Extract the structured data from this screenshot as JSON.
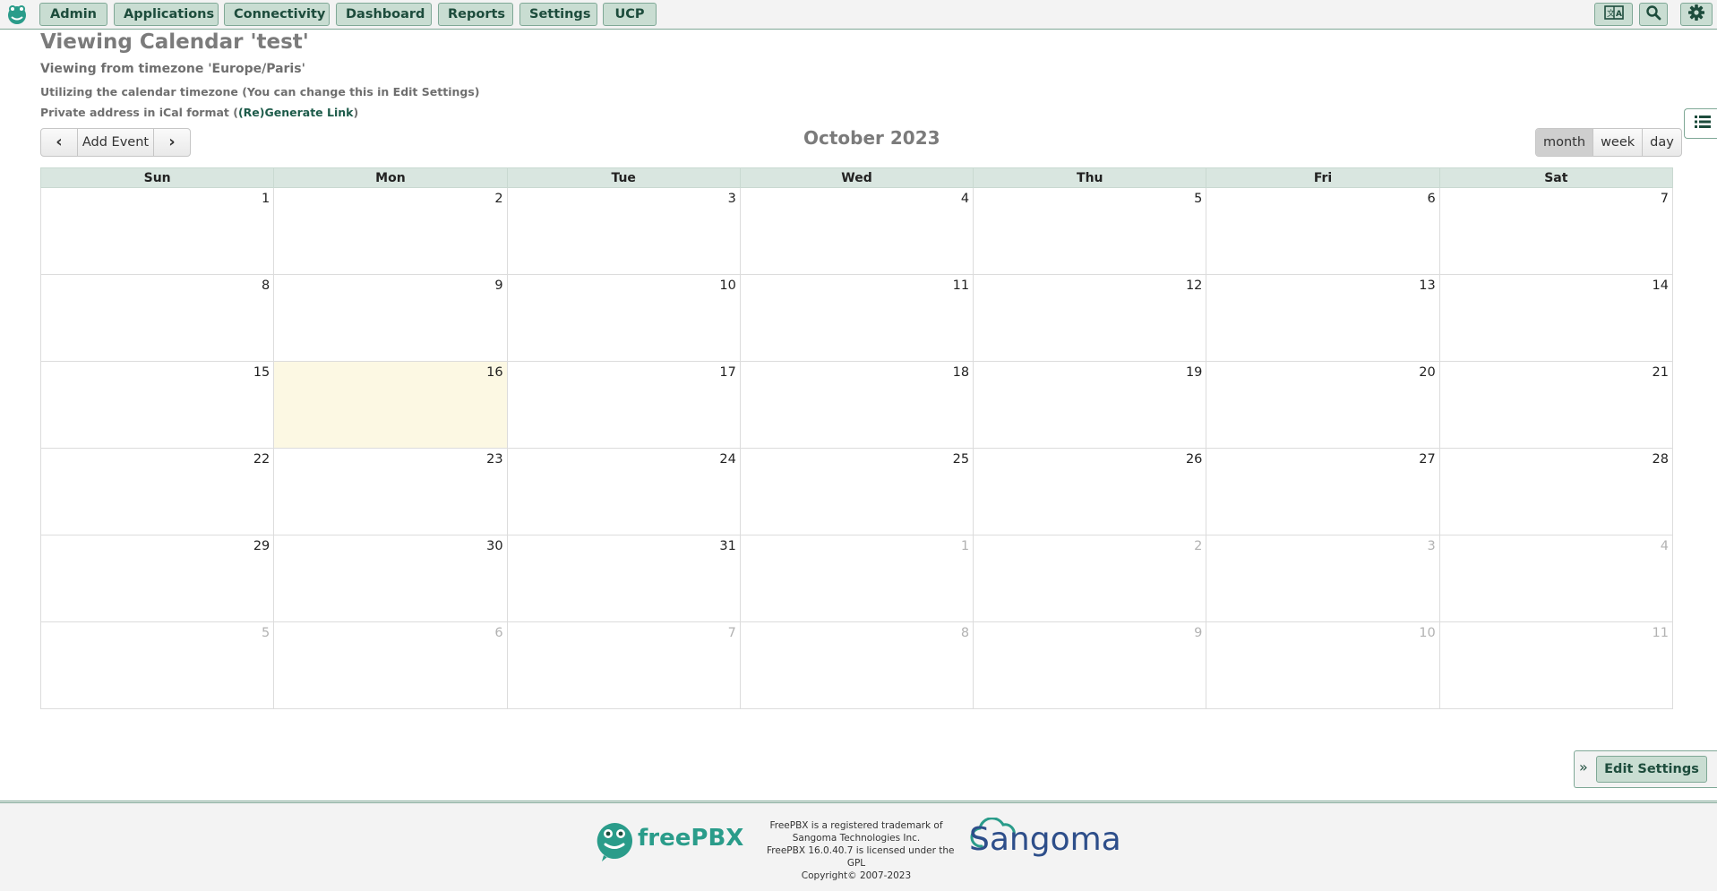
{
  "nav": {
    "items": [
      {
        "label": "Admin"
      },
      {
        "label": "Applications"
      },
      {
        "label": "Connectivity"
      },
      {
        "label": "Dashboard"
      },
      {
        "label": "Reports"
      },
      {
        "label": "Settings"
      },
      {
        "label": "UCP"
      }
    ],
    "right_icons": [
      "language-icon",
      "search-icon",
      "gear-icon"
    ]
  },
  "header": {
    "title": "Viewing Calendar 'test'",
    "timezone": "Viewing from timezone 'Europe/Paris'",
    "note": "Utilizing the calendar timezone (You can change this in Edit Settings)",
    "ical_prefix": "Private address in iCal format (",
    "ical_link": "(Re)Generate Link",
    "ical_suffix": ")"
  },
  "toolbar": {
    "prev_glyph": "‹",
    "add_event": "Add Event",
    "next_glyph": "›",
    "month_title": "October 2023",
    "views": [
      {
        "label": "month",
        "active": true
      },
      {
        "label": "week",
        "active": false
      },
      {
        "label": "day",
        "active": false
      }
    ]
  },
  "calendar": {
    "weekdays": [
      "Sun",
      "Mon",
      "Tue",
      "Wed",
      "Thu",
      "Fri",
      "Sat"
    ],
    "weeks": [
      [
        "1",
        "2",
        "3",
        "4",
        "5",
        "6",
        "7"
      ],
      [
        "8",
        "9",
        "10",
        "11",
        "12",
        "13",
        "14"
      ],
      [
        "15",
        "16",
        "17",
        "18",
        "19",
        "20",
        "21"
      ],
      [
        "22",
        "23",
        "24",
        "25",
        "26",
        "27",
        "28"
      ],
      [
        "29",
        "30",
        "31",
        "1",
        "2",
        "3",
        "4"
      ],
      [
        "5",
        "6",
        "7",
        "8",
        "9",
        "10",
        "11"
      ]
    ],
    "today": "16",
    "colors": {
      "today_bg": "#fcf8e3",
      "header_bg": "#d9e6e0",
      "other_month": "#b2b2b2"
    }
  },
  "side": {
    "list_icon": "list-icon",
    "edit_settings": "Edit Settings",
    "expand_glyph": "»"
  },
  "footer": {
    "freepbx": "freePBX",
    "legal": [
      "FreePBX is a registered trademark of",
      "Sangoma Technologies Inc.",
      "FreePBX 16.0.40.7 is licensed under the",
      "GPL",
      "Copyright© 2007-2023"
    ],
    "sangoma": "Sangoma"
  },
  "colors": {
    "button_bg": "#c9ddd2",
    "button_border": "#7fa896",
    "button_text": "#1d4c3c",
    "brand_teal": "#2a9c8a",
    "sangoma_blue": "#2d4e8a"
  }
}
